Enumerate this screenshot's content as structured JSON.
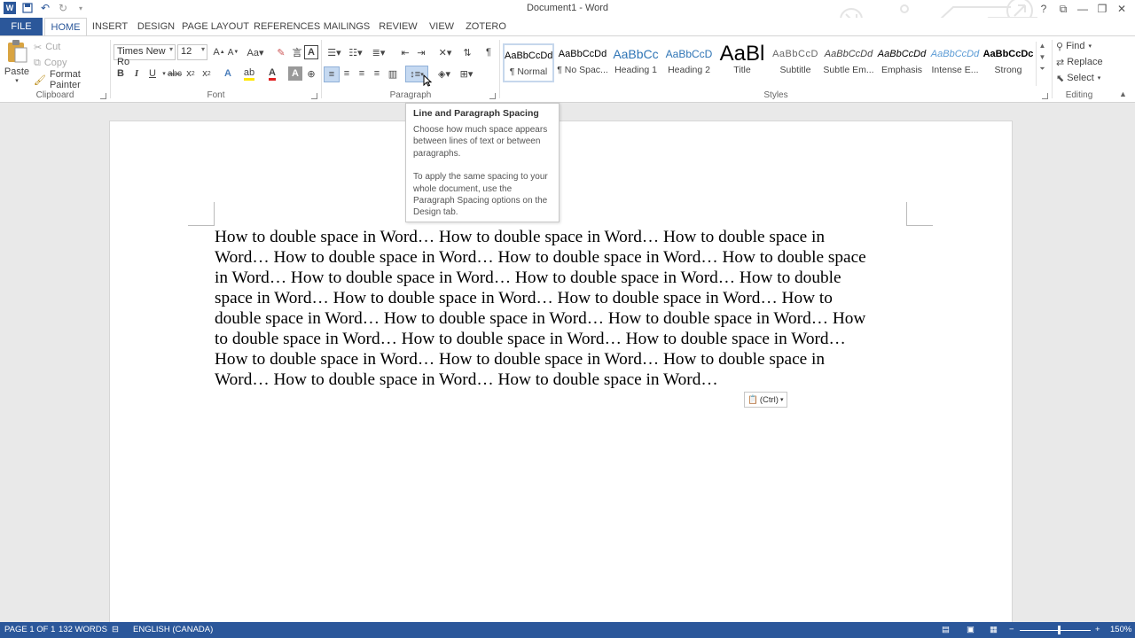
{
  "window": {
    "title": "Document1 - Word",
    "help_icon": "question-icon",
    "controls": [
      "?",
      "⧉",
      "—",
      "❐",
      "✕"
    ]
  },
  "tabs": [
    {
      "label": "FILE"
    },
    {
      "label": "HOME"
    },
    {
      "label": "INSERT"
    },
    {
      "label": "DESIGN"
    },
    {
      "label": "PAGE LAYOUT"
    },
    {
      "label": "REFERENCES"
    },
    {
      "label": "MAILINGS"
    },
    {
      "label": "REVIEW"
    },
    {
      "label": "VIEW"
    },
    {
      "label": "ZOTERO"
    }
  ],
  "clipboard": {
    "label": "Clipboard",
    "paste": "Paste",
    "cut": "Cut",
    "copy": "Copy",
    "format_painter": "Format Painter"
  },
  "font": {
    "label": "Font",
    "family": "Times New Ro",
    "size": "12"
  },
  "paragraph": {
    "label": "Paragraph"
  },
  "styles": {
    "label": "Styles",
    "items": [
      {
        "preview": "AaBbCcDd",
        "name": "¶ Normal"
      },
      {
        "preview": "AaBbCcDd",
        "name": "¶ No Spac..."
      },
      {
        "preview": "AaBbCc",
        "name": "Heading 1"
      },
      {
        "preview": "AaBbCcD",
        "name": "Heading 2"
      },
      {
        "preview": "AaBl",
        "name": "Title"
      },
      {
        "preview": "AaBbCcD",
        "name": "Subtitle"
      },
      {
        "preview": "AaBbCcDd",
        "name": "Subtle Em..."
      },
      {
        "preview": "AaBbCcDd",
        "name": "Emphasis"
      },
      {
        "preview": "AaBbCcDd",
        "name": "Intense E..."
      },
      {
        "preview": "AaBbCcDc",
        "name": "Strong"
      }
    ]
  },
  "editing": {
    "label": "Editing",
    "find": "Find",
    "replace": "Replace",
    "select": "Select"
  },
  "tooltip": {
    "title": "Line and Paragraph Spacing",
    "p1": "Choose how much space appears between lines of text or between paragraphs.",
    "p2": "To apply the same spacing to your whole document, use the Paragraph Spacing options on the Design tab."
  },
  "document": {
    "lines": [
      "How to double space in Word… How to double space in Word… How to double space in",
      "Word… How to double space in Word… How to double space in Word… How to double space",
      "in Word… How to double space in Word… How to double space in Word… How to double",
      "space in Word… How to double space in Word… How to double space in Word… How to",
      "double space in Word… How to double space in Word… How to double space in Word… How",
      "to double space in Word… How to double space in Word… How to double space in Word…",
      "How to double space in Word… How to double space in Word… How to double space in",
      "Word… How to double space in Word… How to double space in Word…"
    ],
    "paste_options": "(Ctrl)"
  },
  "status": {
    "page": "PAGE 1 OF 1",
    "words": "132 WORDS",
    "language": "ENGLISH (CANADA)",
    "zoom": "150%",
    "zoom_level_percent": 150
  }
}
